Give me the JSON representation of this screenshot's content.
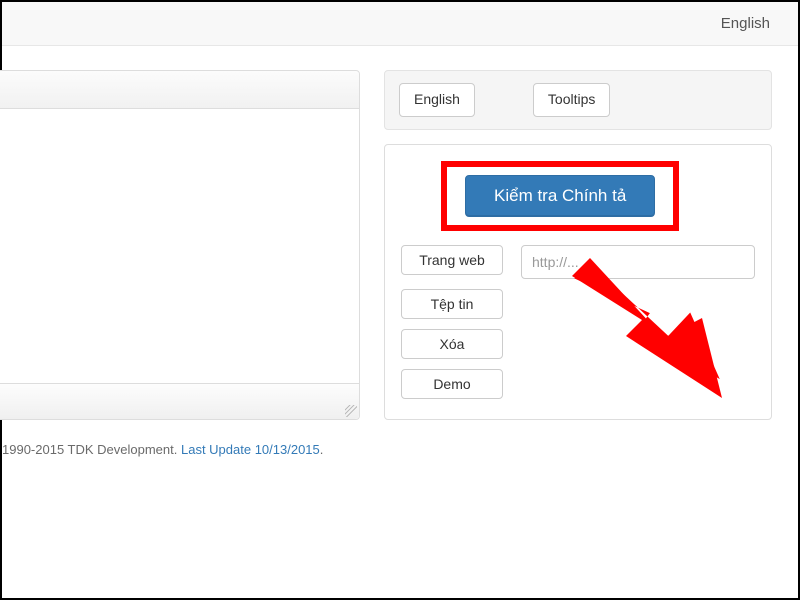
{
  "topbar": {
    "language_link": "English"
  },
  "top_buttons": {
    "english": "English",
    "tooltips": "Tooltips"
  },
  "main": {
    "check_spelling": "Kiểm tra Chính tả",
    "webpage": "Trang web",
    "url_placeholder": "http://...",
    "file": "Tệp tin",
    "clear": "Xóa",
    "demo": "Demo"
  },
  "footer": {
    "copyright": "1990-2015 TDK Development. ",
    "last_update": "Last Update 10/13/2015"
  }
}
